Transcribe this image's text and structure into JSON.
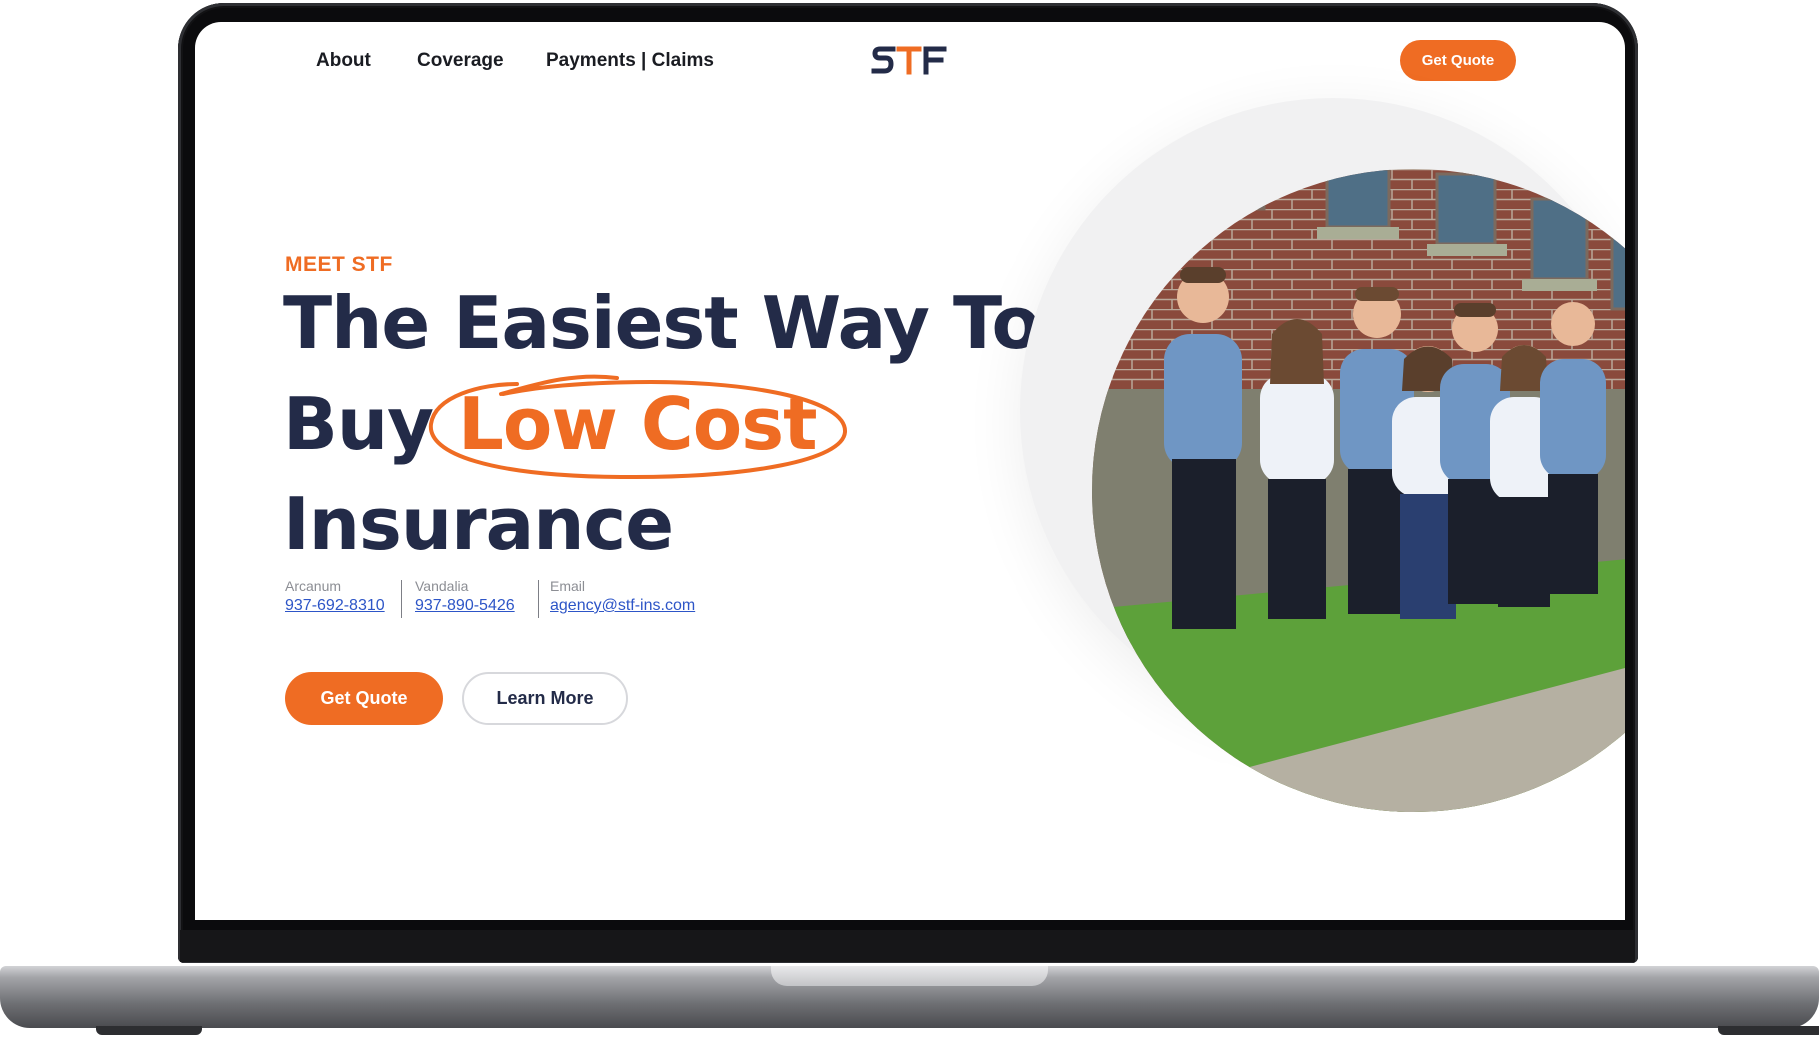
{
  "nav": {
    "links": [
      "About",
      "Coverage",
      "Payments | Claims"
    ],
    "logo_text": "STF",
    "cta_label": "Get Quote"
  },
  "hero": {
    "eyebrow": "MEET STF",
    "line1": "The Easiest Way To",
    "line2_prefix": "Buy",
    "line2_highlight": "Low Cost",
    "line3": "Insurance"
  },
  "contacts": [
    {
      "label": "Arcanum",
      "value": "937-692-8310"
    },
    {
      "label": "Vandalia",
      "value": "937-890-5426"
    },
    {
      "label": "Email",
      "value": "agency@stf-ins.com"
    }
  ],
  "buttons": {
    "primary": "Get Quote",
    "secondary": "Learn More"
  },
  "colors": {
    "accent": "#ef6c23",
    "navy": "#232b48",
    "link": "#2d55c7"
  },
  "icons": [
    "stf-logo",
    "scribble-circle",
    "team-photo"
  ]
}
